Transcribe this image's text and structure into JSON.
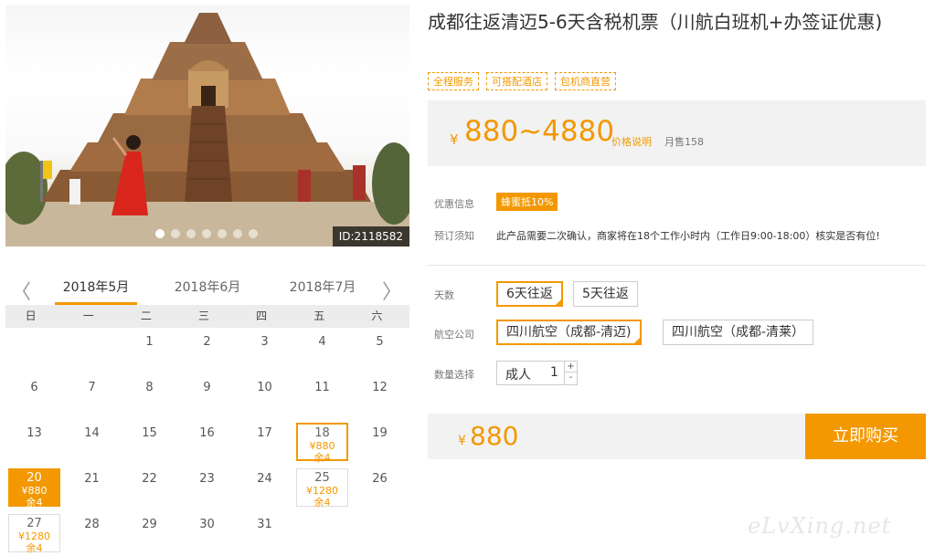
{
  "photo": {
    "id_label": "ID:2118582",
    "slide_count": 7,
    "active_slide": 1
  },
  "calendar": {
    "months": [
      "2018年5月",
      "2018年6月",
      "2018年7月"
    ],
    "active_month": "2018年5月",
    "weekdays": [
      "日",
      "一",
      "二",
      "三",
      "四",
      "五",
      "六"
    ],
    "weeks": [
      [
        null,
        null,
        {
          "day": "1"
        },
        {
          "day": "2"
        },
        {
          "day": "3"
        },
        {
          "day": "4"
        },
        {
          "day": "5"
        }
      ],
      [
        {
          "day": "6"
        },
        {
          "day": "7"
        },
        {
          "day": "8"
        },
        {
          "day": "9"
        },
        {
          "day": "10"
        },
        {
          "day": "11"
        },
        {
          "day": "12"
        }
      ],
      [
        {
          "day": "13"
        },
        {
          "day": "14"
        },
        {
          "day": "15"
        },
        {
          "day": "16"
        },
        {
          "day": "17"
        },
        {
          "day": "18",
          "price": "¥880",
          "left": "余4",
          "state": "hl"
        },
        {
          "day": "19"
        }
      ],
      [
        {
          "day": "20",
          "price": "¥880",
          "left": "余4",
          "state": "sel"
        },
        {
          "day": "21"
        },
        {
          "day": "22"
        },
        {
          "day": "23"
        },
        {
          "day": "24"
        },
        {
          "day": "25",
          "price": "¥1280",
          "left": "余4",
          "state": "avail"
        },
        {
          "day": "26"
        }
      ],
      [
        {
          "day": "27",
          "price": "¥1280",
          "left": "余4",
          "state": "avail"
        },
        {
          "day": "28"
        },
        {
          "day": "29"
        },
        {
          "day": "30"
        },
        {
          "day": "31"
        },
        null,
        null
      ]
    ]
  },
  "product": {
    "title": "成都往返清迈5-6天含税机票（川航白班机+办签证优惠)",
    "tags": [
      "全程服务",
      "可搭配酒店",
      "包机商直营"
    ],
    "currency": "¥",
    "price_range": "880~4880",
    "price_note": "价格说明",
    "monthly_sales": "月售158"
  },
  "info": {
    "promo_label": "优惠信息",
    "promo_badge": "蜂蜜抵10%",
    "notice_label": "预订须知",
    "notice_text": "此产品需要二次确认，商家将在18个工作小时内（工作日9:00-18:00）核实是否有位!"
  },
  "options": {
    "days_label": "天数",
    "days": [
      "6天往返",
      "5天往返"
    ],
    "airline_label": "航空公司",
    "airlines": [
      "四川航空（成都-清迈)",
      "四川航空（成都-清莱）"
    ],
    "qty_label": "数量选择",
    "qty_type": "成人",
    "qty_value": "1",
    "qty_up": "+",
    "qty_down": "-"
  },
  "purchase": {
    "currency": "¥",
    "price": "880",
    "buy_label": "立即购买"
  },
  "nav": {
    "prev": "〈",
    "next": "〉"
  },
  "watermark": "eLvXing.net",
  "colors": {
    "accent": "#f39800",
    "panel": "#f2f2f2"
  }
}
